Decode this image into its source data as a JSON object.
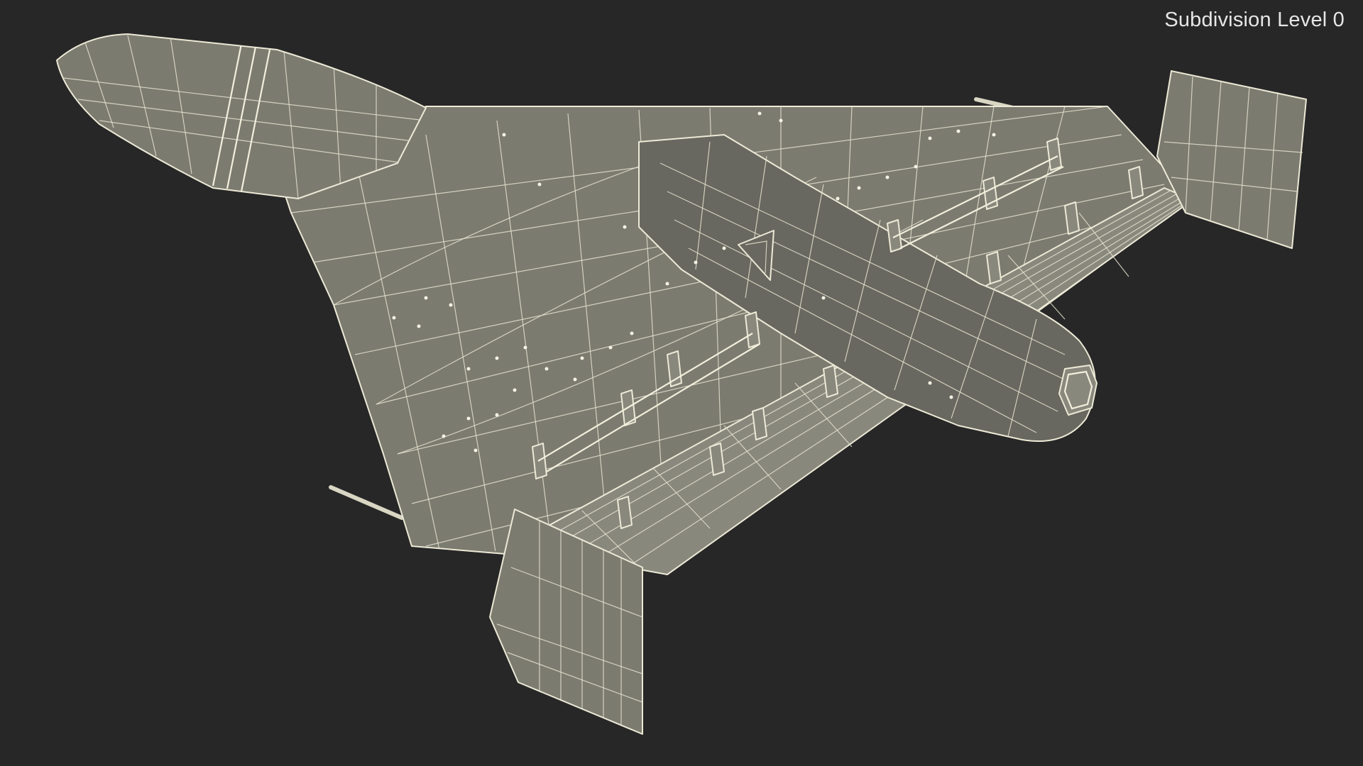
{
  "viewport": {
    "subdivision_label": "Subdivision Level 0",
    "background_color": "#272727",
    "mesh_fill_color": "#7b7b70",
    "wire_color": "#ece9d6"
  },
  "model": {
    "icon": "wireframe-aircraft-model"
  }
}
